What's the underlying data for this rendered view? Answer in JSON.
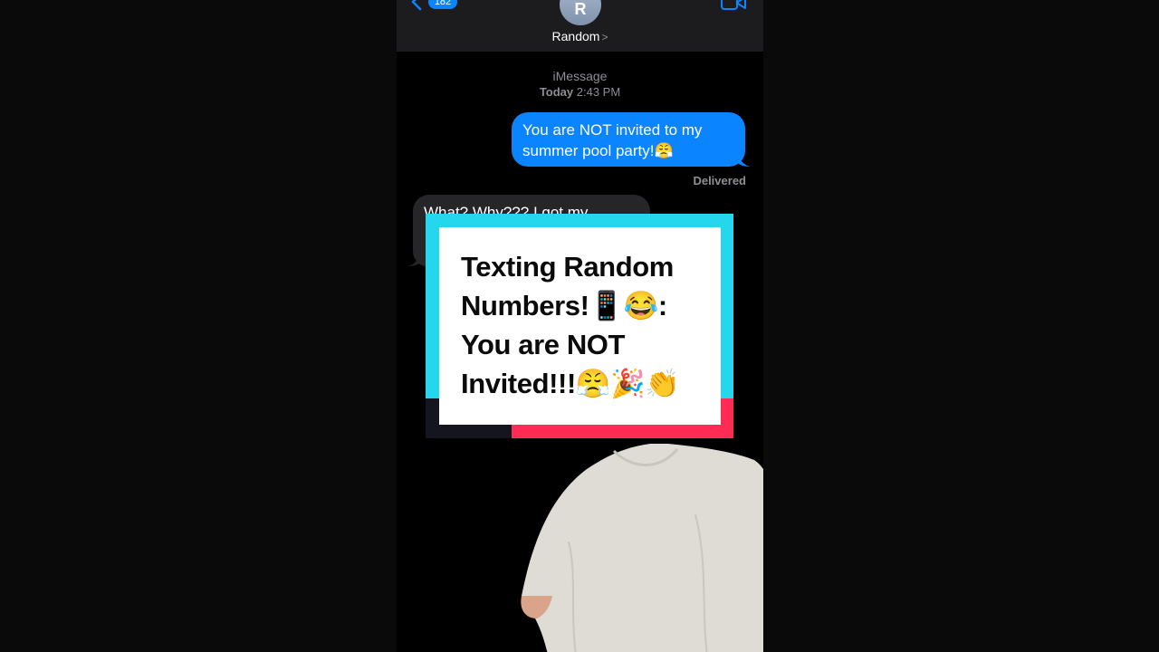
{
  "header": {
    "back_badge": "182",
    "avatar_initial": "R",
    "contact_name": "Random",
    "contact_chevron": ">"
  },
  "conversation": {
    "service": "iMessage",
    "day": "Today",
    "time": "2:43 PM",
    "messages": [
      {
        "from": "me",
        "text": "You are NOT invited to my summer pool party!😤"
      },
      {
        "from": "them",
        "text": "What? Why??? I got my"
      }
    ],
    "status": "Delivered"
  },
  "overlay": {
    "line1": "Texting Random",
    "line2": "Numbers!📱😂:",
    "line3": "You are NOT",
    "line4": "Invited!!!😤🎉👏"
  },
  "colors": {
    "sent_bubble": "#0a84ff",
    "received_bubble": "#262629",
    "overlay_cyan": "#25d7ec",
    "overlay_red": "#fe2c55"
  }
}
